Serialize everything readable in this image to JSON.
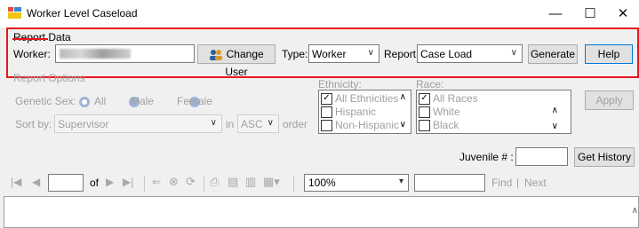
{
  "window": {
    "title": "Worker Level Caseload",
    "minimize": "—",
    "maximize": "☐",
    "close": "✕"
  },
  "report_data": {
    "group_label": "Report Data",
    "worker_label": "Worker:",
    "change_user_label": "Change User",
    "type_label": "Type:",
    "type_value": "Worker",
    "report_label": "Report:",
    "report_value": "Case Load",
    "generate_label": "Generate",
    "help_label": "Help"
  },
  "report_options": {
    "group_label": "Report Options",
    "genetic_sex_label": "Genetic Sex:",
    "sex_options": [
      "All",
      "Male",
      "Female"
    ],
    "sort_by_label": "Sort by:",
    "sort_by_value": "Supervisor",
    "in_label": "in",
    "order_value": "ASC",
    "order_label": "order",
    "ethnicity_label": "Ethnicity:",
    "ethnicity_items": [
      {
        "label": "All Ethnicities",
        "checked": true
      },
      {
        "label": "Hispanic",
        "checked": false
      },
      {
        "label": "Non-Hispanic",
        "checked": false
      }
    ],
    "race_label": "Race:",
    "race_items": [
      {
        "label": "All Races",
        "checked": true
      },
      {
        "label": "White",
        "checked": false
      },
      {
        "label": "Black",
        "checked": false
      }
    ],
    "apply_label": "Apply",
    "juvenile_label": "Juvenile # :",
    "juvenile_value": "",
    "get_history_label": "Get History"
  },
  "toolbar": {
    "page_value": "",
    "of_label": "of",
    "zoom_value": "100%",
    "find_value": "",
    "find_label": "Find",
    "separator": "|",
    "next_label": "Next"
  }
}
